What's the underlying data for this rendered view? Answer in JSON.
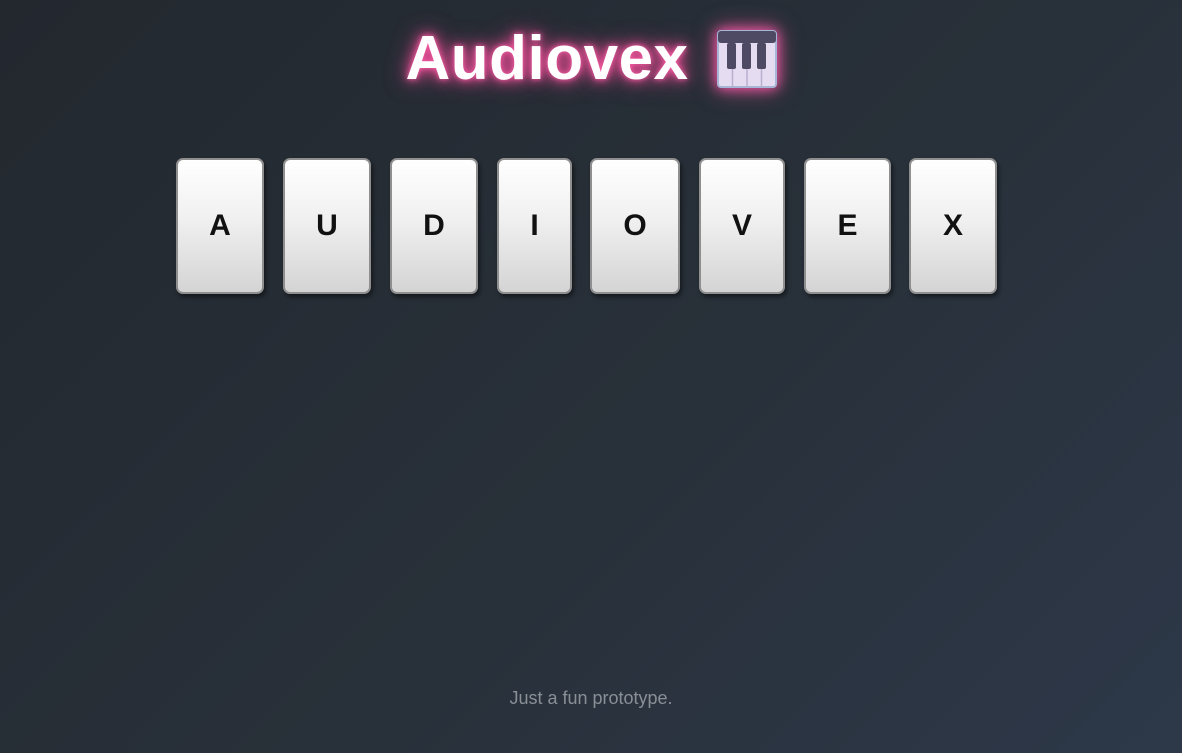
{
  "header": {
    "title": "Audiovex",
    "icon": "piano-icon"
  },
  "tiles": [
    {
      "letter": "A"
    },
    {
      "letter": "U"
    },
    {
      "letter": "D"
    },
    {
      "letter": "I"
    },
    {
      "letter": "O"
    },
    {
      "letter": "V"
    },
    {
      "letter": "E"
    },
    {
      "letter": "X"
    }
  ],
  "footer": {
    "text": "Just a fun prototype."
  },
  "colors": {
    "title_glow": "#ff4f9e",
    "tile_border": "#8f8f8f",
    "background": "#262d36"
  }
}
